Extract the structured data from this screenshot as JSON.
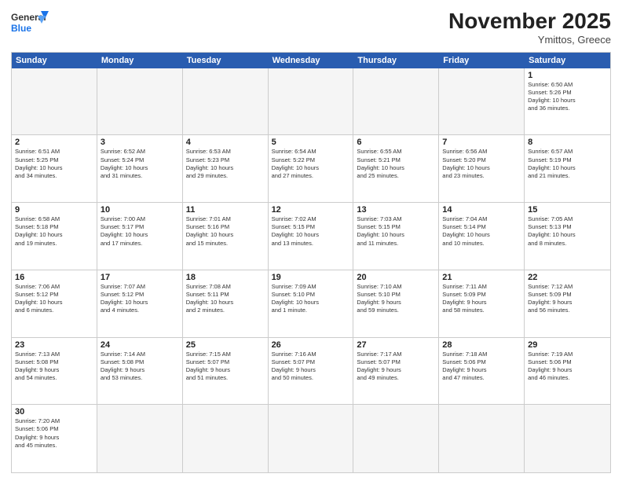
{
  "header": {
    "logo_line1": "General",
    "logo_line2": "Blue",
    "month_title": "November 2025",
    "subtitle": "Ymittos, Greece"
  },
  "days": [
    "Sunday",
    "Monday",
    "Tuesday",
    "Wednesday",
    "Thursday",
    "Friday",
    "Saturday"
  ],
  "cells": [
    {
      "day": "",
      "empty": true,
      "text": ""
    },
    {
      "day": "",
      "empty": true,
      "text": ""
    },
    {
      "day": "",
      "empty": true,
      "text": ""
    },
    {
      "day": "",
      "empty": true,
      "text": ""
    },
    {
      "day": "",
      "empty": true,
      "text": ""
    },
    {
      "day": "",
      "empty": true,
      "text": ""
    },
    {
      "day": "1",
      "empty": false,
      "text": "Sunrise: 6:50 AM\nSunset: 5:26 PM\nDaylight: 10 hours\nand 36 minutes."
    },
    {
      "day": "2",
      "empty": false,
      "text": "Sunrise: 6:51 AM\nSunset: 5:25 PM\nDaylight: 10 hours\nand 34 minutes."
    },
    {
      "day": "3",
      "empty": false,
      "text": "Sunrise: 6:52 AM\nSunset: 5:24 PM\nDaylight: 10 hours\nand 31 minutes."
    },
    {
      "day": "4",
      "empty": false,
      "text": "Sunrise: 6:53 AM\nSunset: 5:23 PM\nDaylight: 10 hours\nand 29 minutes."
    },
    {
      "day": "5",
      "empty": false,
      "text": "Sunrise: 6:54 AM\nSunset: 5:22 PM\nDaylight: 10 hours\nand 27 minutes."
    },
    {
      "day": "6",
      "empty": false,
      "text": "Sunrise: 6:55 AM\nSunset: 5:21 PM\nDaylight: 10 hours\nand 25 minutes."
    },
    {
      "day": "7",
      "empty": false,
      "text": "Sunrise: 6:56 AM\nSunset: 5:20 PM\nDaylight: 10 hours\nand 23 minutes."
    },
    {
      "day": "8",
      "empty": false,
      "text": "Sunrise: 6:57 AM\nSunset: 5:19 PM\nDaylight: 10 hours\nand 21 minutes."
    },
    {
      "day": "9",
      "empty": false,
      "text": "Sunrise: 6:58 AM\nSunset: 5:18 PM\nDaylight: 10 hours\nand 19 minutes."
    },
    {
      "day": "10",
      "empty": false,
      "text": "Sunrise: 7:00 AM\nSunset: 5:17 PM\nDaylight: 10 hours\nand 17 minutes."
    },
    {
      "day": "11",
      "empty": false,
      "text": "Sunrise: 7:01 AM\nSunset: 5:16 PM\nDaylight: 10 hours\nand 15 minutes."
    },
    {
      "day": "12",
      "empty": false,
      "text": "Sunrise: 7:02 AM\nSunset: 5:15 PM\nDaylight: 10 hours\nand 13 minutes."
    },
    {
      "day": "13",
      "empty": false,
      "text": "Sunrise: 7:03 AM\nSunset: 5:15 PM\nDaylight: 10 hours\nand 11 minutes."
    },
    {
      "day": "14",
      "empty": false,
      "text": "Sunrise: 7:04 AM\nSunset: 5:14 PM\nDaylight: 10 hours\nand 10 minutes."
    },
    {
      "day": "15",
      "empty": false,
      "text": "Sunrise: 7:05 AM\nSunset: 5:13 PM\nDaylight: 10 hours\nand 8 minutes."
    },
    {
      "day": "16",
      "empty": false,
      "text": "Sunrise: 7:06 AM\nSunset: 5:12 PM\nDaylight: 10 hours\nand 6 minutes."
    },
    {
      "day": "17",
      "empty": false,
      "text": "Sunrise: 7:07 AM\nSunset: 5:12 PM\nDaylight: 10 hours\nand 4 minutes."
    },
    {
      "day": "18",
      "empty": false,
      "text": "Sunrise: 7:08 AM\nSunset: 5:11 PM\nDaylight: 10 hours\nand 2 minutes."
    },
    {
      "day": "19",
      "empty": false,
      "text": "Sunrise: 7:09 AM\nSunset: 5:10 PM\nDaylight: 10 hours\nand 1 minute."
    },
    {
      "day": "20",
      "empty": false,
      "text": "Sunrise: 7:10 AM\nSunset: 5:10 PM\nDaylight: 9 hours\nand 59 minutes."
    },
    {
      "day": "21",
      "empty": false,
      "text": "Sunrise: 7:11 AM\nSunset: 5:09 PM\nDaylight: 9 hours\nand 58 minutes."
    },
    {
      "day": "22",
      "empty": false,
      "text": "Sunrise: 7:12 AM\nSunset: 5:09 PM\nDaylight: 9 hours\nand 56 minutes."
    },
    {
      "day": "23",
      "empty": false,
      "text": "Sunrise: 7:13 AM\nSunset: 5:08 PM\nDaylight: 9 hours\nand 54 minutes."
    },
    {
      "day": "24",
      "empty": false,
      "text": "Sunrise: 7:14 AM\nSunset: 5:08 PM\nDaylight: 9 hours\nand 53 minutes."
    },
    {
      "day": "25",
      "empty": false,
      "text": "Sunrise: 7:15 AM\nSunset: 5:07 PM\nDaylight: 9 hours\nand 51 minutes."
    },
    {
      "day": "26",
      "empty": false,
      "text": "Sunrise: 7:16 AM\nSunset: 5:07 PM\nDaylight: 9 hours\nand 50 minutes."
    },
    {
      "day": "27",
      "empty": false,
      "text": "Sunrise: 7:17 AM\nSunset: 5:07 PM\nDaylight: 9 hours\nand 49 minutes."
    },
    {
      "day": "28",
      "empty": false,
      "text": "Sunrise: 7:18 AM\nSunset: 5:06 PM\nDaylight: 9 hours\nand 47 minutes."
    },
    {
      "day": "29",
      "empty": false,
      "text": "Sunrise: 7:19 AM\nSunset: 5:06 PM\nDaylight: 9 hours\nand 46 minutes."
    },
    {
      "day": "30",
      "empty": false,
      "text": "Sunrise: 7:20 AM\nSunset: 5:06 PM\nDaylight: 9 hours\nand 45 minutes."
    },
    {
      "day": "",
      "empty": true,
      "text": ""
    },
    {
      "day": "",
      "empty": true,
      "text": ""
    },
    {
      "day": "",
      "empty": true,
      "text": ""
    },
    {
      "day": "",
      "empty": true,
      "text": ""
    },
    {
      "day": "",
      "empty": true,
      "text": ""
    },
    {
      "day": "",
      "empty": true,
      "text": ""
    }
  ]
}
